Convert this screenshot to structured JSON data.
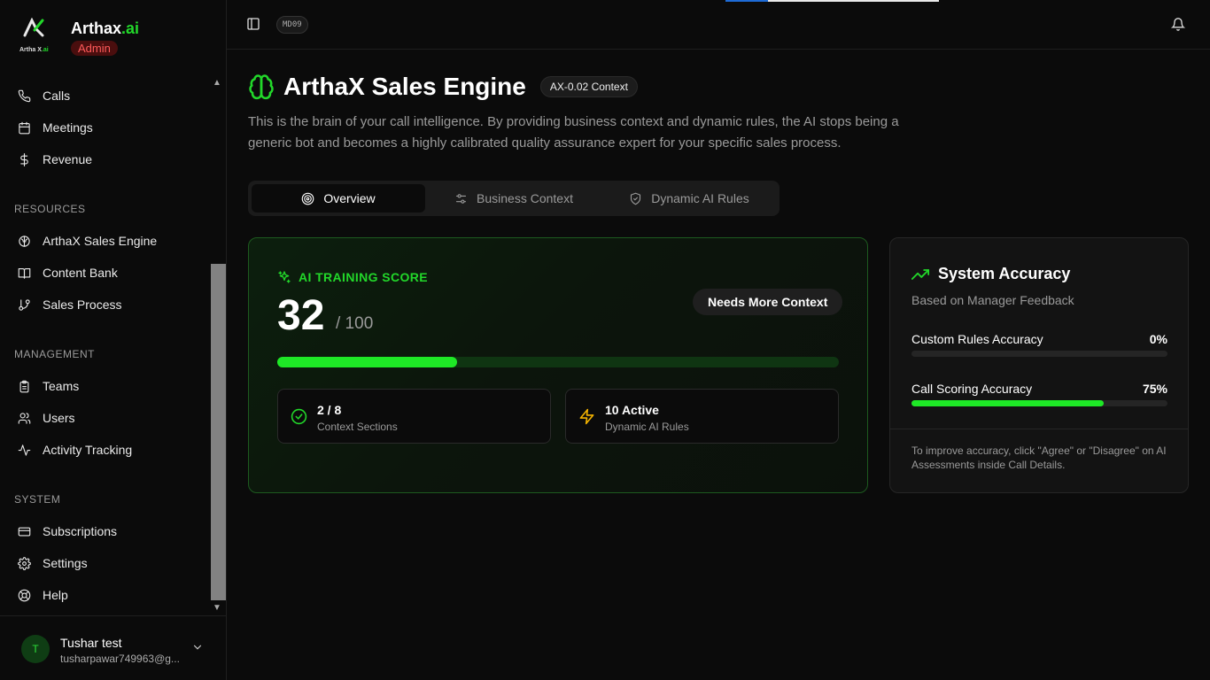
{
  "brand": {
    "name": "Arthax",
    "name_suffix": ".ai",
    "role_badge": "Admin",
    "logo_text": "Artha X",
    "logo_text_suffix": ".ai"
  },
  "sidebar": {
    "items_top": [
      {
        "label": "Calls",
        "icon": "phone-icon"
      },
      {
        "label": "Meetings",
        "icon": "calendar-icon"
      },
      {
        "label": "Revenue",
        "icon": "dollar-icon"
      }
    ],
    "sections": [
      {
        "title": "RESOURCES",
        "items": [
          {
            "label": "ArthaX Sales Engine",
            "icon": "brain-icon"
          },
          {
            "label": "Content Bank",
            "icon": "book-icon"
          },
          {
            "label": "Sales Process",
            "icon": "git-branch-icon"
          }
        ]
      },
      {
        "title": "MANAGEMENT",
        "items": [
          {
            "label": "Teams",
            "icon": "clipboard-icon"
          },
          {
            "label": "Users",
            "icon": "users-icon"
          },
          {
            "label": "Activity Tracking",
            "icon": "activity-icon"
          }
        ]
      },
      {
        "title": "SYSTEM",
        "items": [
          {
            "label": "Subscriptions",
            "icon": "credit-card-icon"
          },
          {
            "label": "Settings",
            "icon": "gear-icon"
          },
          {
            "label": "Help",
            "icon": "lifebuoy-icon"
          }
        ]
      }
    ]
  },
  "user": {
    "initial": "T",
    "name": "Tushar test",
    "email": "tusharpawar749963@g..."
  },
  "topbar": {
    "model_badge": "MD09"
  },
  "page": {
    "title": "ArthaX Sales Engine",
    "context_badge": "AX-0.02 Context",
    "description": "This is the brain of your call intelligence. By providing business context and dynamic rules, the AI stops being a generic bot and becomes a highly calibrated quality assurance expert for your specific sales process."
  },
  "tabs": [
    {
      "label": "Overview",
      "active": true,
      "icon": "target-icon"
    },
    {
      "label": "Business Context",
      "active": false,
      "icon": "sliders-icon"
    },
    {
      "label": "Dynamic AI Rules",
      "active": false,
      "icon": "shield-check-icon"
    }
  ],
  "training": {
    "label": "AI TRAINING SCORE",
    "score": "32",
    "max": "/ 100",
    "score_fraction": 0.32,
    "status_badge": "Needs More Context",
    "cards": [
      {
        "title": "2 / 8",
        "subtitle": "Context Sections",
        "icon": "check-circle-icon"
      },
      {
        "title": "10 Active",
        "subtitle": "Dynamic AI Rules",
        "icon": "zap-icon"
      }
    ]
  },
  "accuracy": {
    "title": "System Accuracy",
    "subtitle": "Based on Manager Feedback",
    "rows": [
      {
        "label": "Custom Rules Accuracy",
        "value": "0%",
        "fraction": 0
      },
      {
        "label": "Call Scoring Accuracy",
        "value": "75%",
        "fraction": 0.75
      }
    ],
    "footnote": "To improve accuracy, click \"Agree\" or \"Disagree\" on AI Assessments inside Call Details."
  },
  "colors": {
    "accent": "#22d82a",
    "background": "#0b0b0b",
    "admin_badge": "#ff5a5a",
    "warning": "#f5b400"
  }
}
